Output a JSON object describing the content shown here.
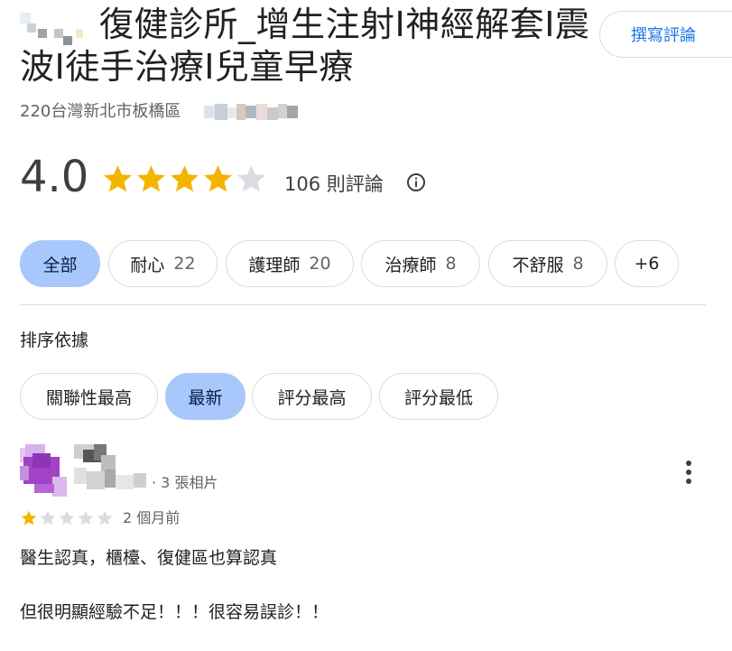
{
  "place": {
    "title": "復健診所_增生注射I神經解套I震波I徒手治療I兒童早療",
    "address": "220台灣新北市板橋區",
    "write_review_label": "撰寫評論"
  },
  "rating": {
    "value": "4.0",
    "stars_filled": 4,
    "stars_total": 5,
    "review_count_text": "106 則評論",
    "star_color": "#f5b400",
    "star_empty_color": "#dadce0"
  },
  "topic_chips": [
    {
      "label": "全部",
      "count": "",
      "active": true
    },
    {
      "label": "耐心",
      "count": "22",
      "active": false
    },
    {
      "label": "護理師",
      "count": "20",
      "active": false
    },
    {
      "label": "治療師",
      "count": "8",
      "active": false
    },
    {
      "label": "不舒服",
      "count": "8",
      "active": false
    },
    {
      "label": "+6",
      "count": "",
      "active": false
    }
  ],
  "sort": {
    "label": "排序依據",
    "options": [
      {
        "label": "關聯性最高",
        "active": false
      },
      {
        "label": "最新",
        "active": true
      },
      {
        "label": "評分最高",
        "active": false
      },
      {
        "label": "評分最低",
        "active": false
      }
    ]
  },
  "review": {
    "meta": "· 3 張相片",
    "stars_filled": 1,
    "stars_total": 5,
    "time": "2 個月前",
    "text_line1": "醫生認真，櫃檯、復健區也算認真",
    "text_line2": "但很明顯經驗不足！！！很容易誤診！！",
    "more_icon": "more-vert-icon"
  },
  "colors": {
    "accent": "#1a73e8",
    "chip_active": "#a8c7fa",
    "avatar": "#a142c7"
  }
}
